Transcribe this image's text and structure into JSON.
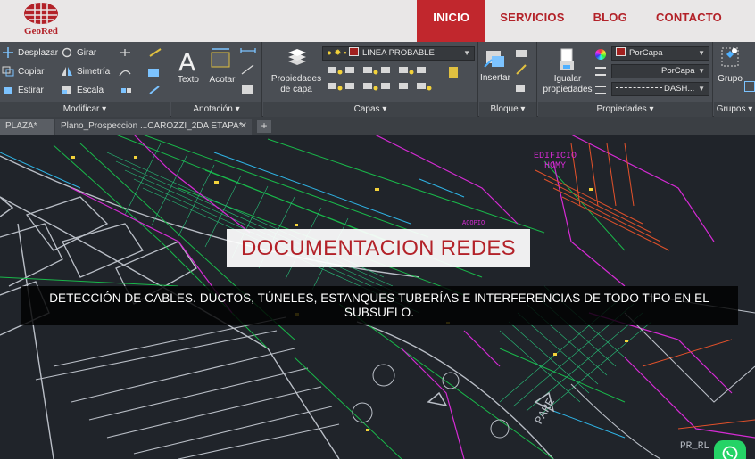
{
  "site": {
    "brand": "GeoRed",
    "nav": [
      "INICIO",
      "SERVICIOS",
      "BLOG",
      "CONTACTO"
    ],
    "active_nav": "INICIO",
    "accent_color": "#c1272d"
  },
  "ribbon": {
    "modificar": {
      "title": "Modificar",
      "tools": [
        "Desplazar",
        "Girar",
        "Copiar",
        "Simetría",
        "Estirar",
        "Escala"
      ]
    },
    "anotacion": {
      "title": "Anotación",
      "tools": [
        "Texto",
        "Acotar"
      ]
    },
    "capas": {
      "title": "Capas",
      "layer_props": "Propiedades de capa",
      "current_layer": "LINEA PROBABLE"
    },
    "bloque": {
      "title": "Bloque",
      "insert": "Insertar"
    },
    "propiedades": {
      "title": "Propiedades",
      "match": "Igualar propiedades",
      "color": "PorCapa",
      "lineweight": "PorCapa",
      "linetype": "DASH..."
    },
    "grupos": {
      "title": "Grupos",
      "group": "Grupo"
    }
  },
  "tabs": {
    "tab1": "PLAZA*",
    "tab2": "Plano_Prospeccion ...CAROZZI_2DA ETAPA*"
  },
  "drawing_labels": {
    "edificio": "EDIFICIO",
    "homy": "HOMY",
    "acopio": "ACOPIO",
    "parking": "PARE",
    "pr": "PR_RL"
  },
  "hero": {
    "title": "DOCUMENTACION REDES",
    "subtitle": "DETECCIÓN DE CABLES. DUCTOS, TÚNELES, ESTANQUES TUBERÍAS E INTERFERENCIAS DE TODO TIPO EN EL SUBSUELO."
  }
}
